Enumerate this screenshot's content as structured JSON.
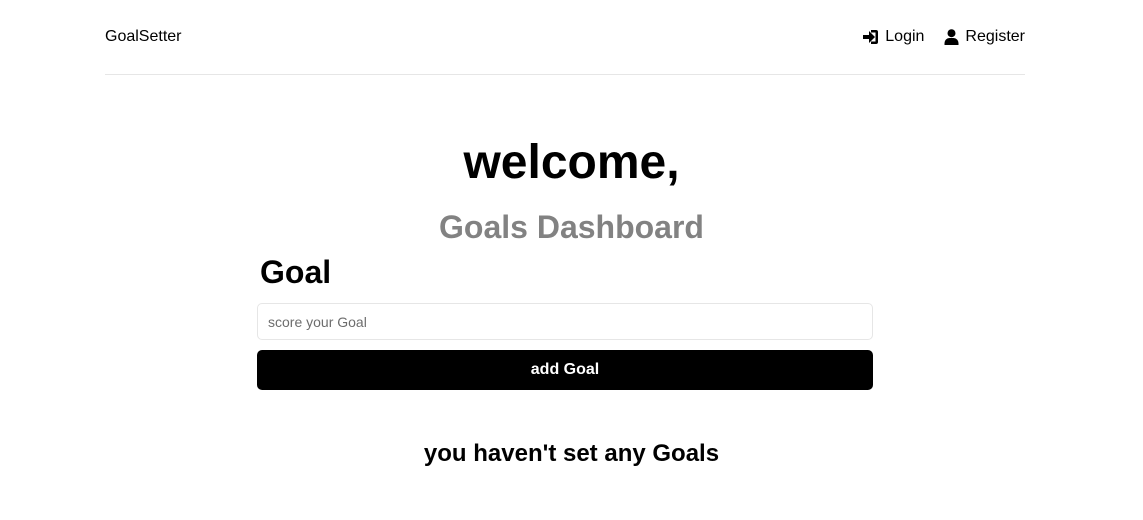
{
  "header": {
    "logo": "GoalSetter",
    "nav": [
      {
        "label": "Login",
        "icon": "sign-in-icon"
      },
      {
        "label": "Register",
        "icon": "user-icon"
      }
    ]
  },
  "main": {
    "welcome": "welcome,",
    "subtitle": "Goals Dashboard",
    "form": {
      "label": "Goal",
      "input_value": "",
      "input_placeholder": "score your Goal",
      "button_label": "add Goal"
    },
    "empty_message": "you haven't set any Goals"
  },
  "colors": {
    "subtitle": "#828282",
    "button_bg": "#000000",
    "divider": "#e6e6e6"
  }
}
